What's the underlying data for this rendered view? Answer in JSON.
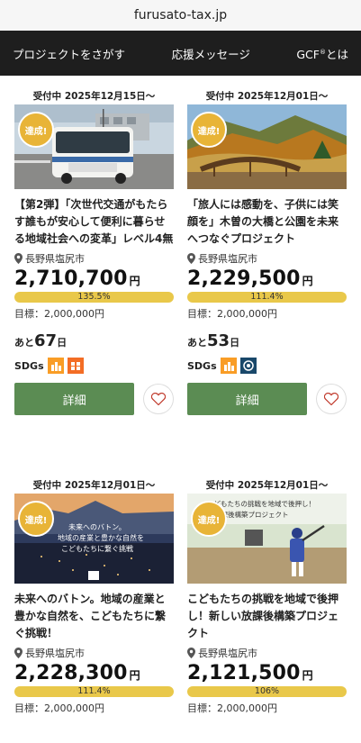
{
  "browser": {
    "url": "furusato-tax.jp"
  },
  "nav": {
    "items": [
      {
        "label": "プロジェクトをさがす"
      },
      {
        "label": "応援メッセージ"
      },
      {
        "label": "GCF",
        "suffix": "®とは"
      }
    ]
  },
  "cards": [
    {
      "accepting": "受付中 2025年12月15日〜",
      "achieved_badge": "達成!",
      "title": "【第2弾】「次世代交通がもたらす誰もが安心して便利に暮らせる地域社会への変革」レベル4無人",
      "location": "長野県塩尻市",
      "amount": "2,710,700",
      "yen": "円",
      "progress_label": "135.5%",
      "goal": "目標：2,000,000円",
      "remain_prefix": "あと",
      "remain_days": "67",
      "remain_suffix": "日",
      "sdgs_label": "SDGs",
      "button": "詳細"
    },
    {
      "accepting": "受付中 2025年12月01日〜",
      "achieved_badge": "達成!",
      "title": "「旅人には感動を、子供には笑顔を」木曽の大橋と公園を未来へつなぐプロジェクト",
      "location": "長野県塩尻市",
      "amount": "2,229,500",
      "yen": "円",
      "progress_label": "111.4%",
      "goal": "目標：2,000,000円",
      "remain_prefix": "あと",
      "remain_days": "53",
      "remain_suffix": "日",
      "sdgs_label": "SDGs",
      "button": "詳細"
    },
    {
      "accepting": "受付中 2025年12月01日〜",
      "achieved_badge": "達成!",
      "title": "未来へのバトン。地域の産業と豊かな自然を、こどもたちに繋ぐ挑戦！",
      "location": "長野県塩尻市",
      "amount": "2,228,300",
      "yen": "円",
      "progress_label": "111.4%",
      "goal": "目標：2,000,000円",
      "image_text": "未来へのバトン。地域の産業と豊かな自然をこどもたちに繋ぐ挑戦"
    },
    {
      "accepting": "受付中 2025年12月01日〜",
      "achieved_badge": "達成!",
      "title": "こどもたちの挑戦を地域で後押し！新しい放課後構築プロジェクト",
      "location": "長野県塩尻市",
      "amount": "2,121,500",
      "yen": "円",
      "progress_label": "106%",
      "goal": "目標：2,000,000円",
      "image_text": "こどもたちの挑戦を地域で後押し！放課後構築プロジェクト"
    }
  ],
  "colors": {
    "nav_bg": "#1e1e1e",
    "button_green": "#5b8c53",
    "progress_yellow": "#e9c84a",
    "badge_gold": "#e8b437"
  }
}
